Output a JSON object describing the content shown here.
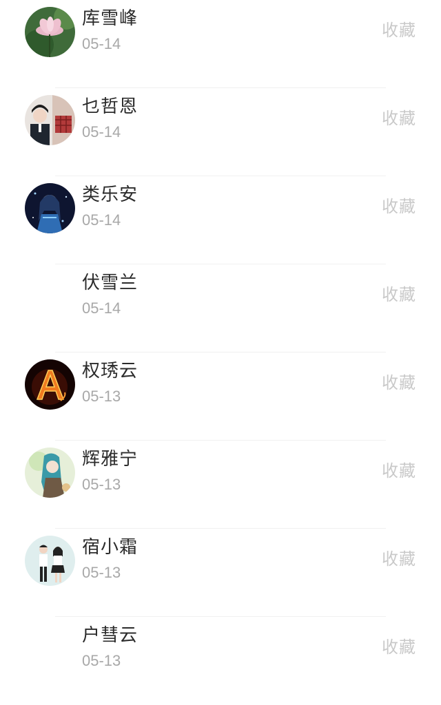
{
  "contacts": [
    {
      "name": "库雪峰",
      "date": "05-14",
      "action": "收藏",
      "avatar": "lotus-flower-avatar"
    },
    {
      "name": "乜哲恩",
      "date": "05-14",
      "action": "收藏",
      "avatar": "couple-photo-avatar"
    },
    {
      "name": "类乐安",
      "date": "05-14",
      "action": "收藏",
      "avatar": "anime-girl-avatar"
    },
    {
      "name": "伏雪兰",
      "date": "05-14",
      "action": "收藏",
      "avatar": ""
    },
    {
      "name": "权琇云",
      "date": "05-13",
      "action": "收藏",
      "avatar": "fire-letter-a-avatar"
    },
    {
      "name": "辉雅宁",
      "date": "05-13",
      "action": "收藏",
      "avatar": "anime-illustration-avatar"
    },
    {
      "name": "宿小霜",
      "date": "05-13",
      "action": "收藏",
      "avatar": "couple-standing-avatar"
    },
    {
      "name": "户彗云",
      "date": "05-13",
      "action": "收藏",
      "avatar": ""
    }
  ]
}
